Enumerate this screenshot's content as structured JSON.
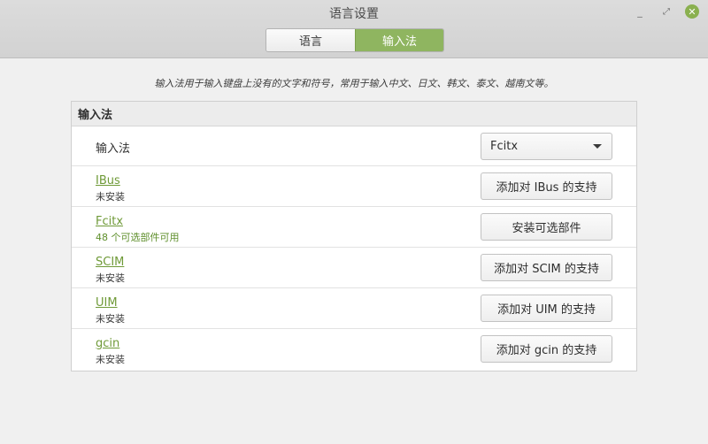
{
  "window": {
    "title": "语言设置",
    "controls": {
      "minimize": "_",
      "maximize": "⤢",
      "close": "✕"
    }
  },
  "tabs": [
    {
      "label": "语言",
      "active": false
    },
    {
      "label": "输入法",
      "active": true
    }
  ],
  "description": "输入法用于输入键盘上没有的文字和符号，常用于输入中文、日文、韩文、泰文、越南文等。",
  "panel": {
    "title": "输入法",
    "selector": {
      "label": "输入法",
      "value": "Fcitx"
    },
    "frameworks": [
      {
        "name": "IBus",
        "status": "未安装",
        "button": "添加对 IBus 的支持"
      },
      {
        "name": "Fcitx",
        "status": "48 个可选部件可用",
        "button": "安装可选部件"
      },
      {
        "name": "SCIM",
        "status": "未安装",
        "button": "添加对 SCIM 的支持"
      },
      {
        "name": "UIM",
        "status": "未安装",
        "button": "添加对 UIM 的支持"
      },
      {
        "name": "gcin",
        "status": "未安装",
        "button": "添加对 gcin 的支持"
      }
    ]
  },
  "colors": {
    "accent": "#8fb560",
    "link": "#6f9a38",
    "close_button": "#8ab04f"
  }
}
